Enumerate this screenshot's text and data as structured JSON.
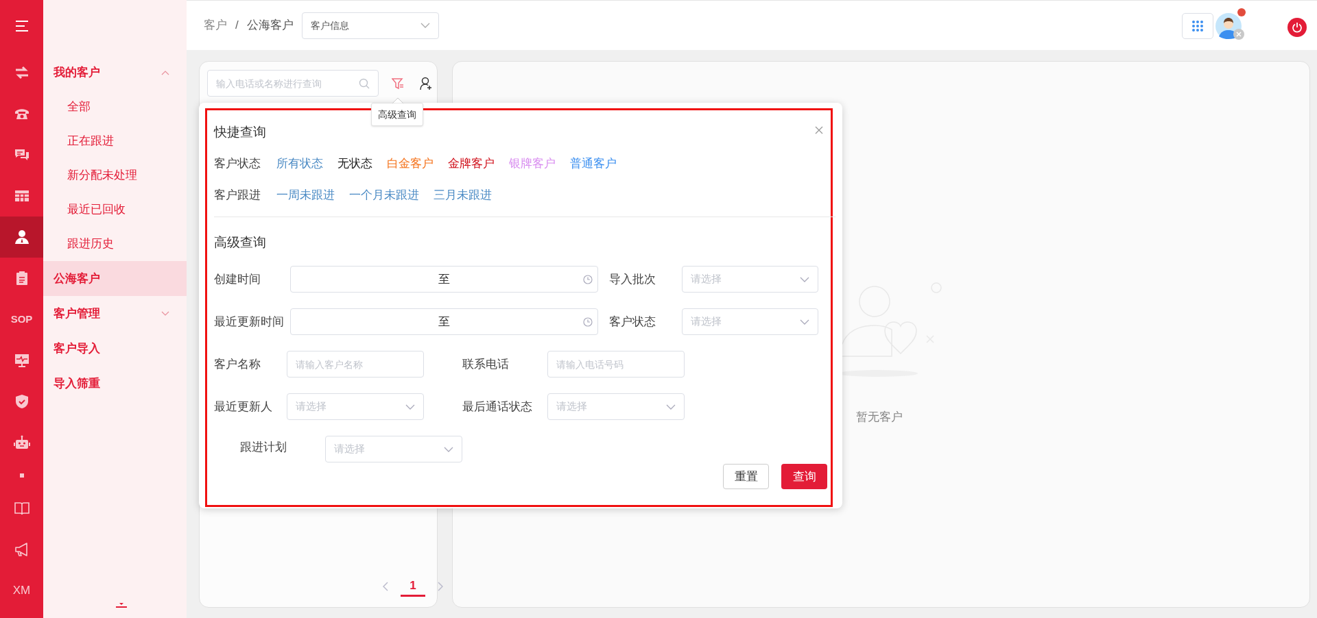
{
  "rail": [
    {
      "kind": "menu",
      "selected": false
    },
    {
      "kind": "swap",
      "selected": false
    },
    {
      "kind": "phone",
      "selected": false
    },
    {
      "kind": "chat",
      "selected": false
    },
    {
      "kind": "grid",
      "selected": false
    },
    {
      "kind": "person",
      "selected": true
    },
    {
      "kind": "clipboard",
      "selected": false
    },
    {
      "kind": "text",
      "label": "SOP",
      "selected": false
    },
    {
      "kind": "monitor",
      "selected": false
    },
    {
      "kind": "shield",
      "selected": false
    },
    {
      "kind": "robot",
      "selected": false
    },
    {
      "kind": "dot",
      "selected": false
    },
    {
      "kind": "book",
      "selected": false
    },
    {
      "kind": "megaphone",
      "selected": false
    },
    {
      "kind": "text",
      "label": "XM",
      "selected": false
    }
  ],
  "sidebar": {
    "items": [
      {
        "kind": "group",
        "label": "我的客户",
        "expanded": true,
        "selected": false,
        "children": [
          {
            "label": "全部"
          },
          {
            "label": "正在跟进"
          },
          {
            "label": "新分配未处理"
          },
          {
            "label": "最近已回收"
          },
          {
            "label": "跟进历史"
          }
        ]
      },
      {
        "kind": "link",
        "label": "公海客户",
        "selected": true
      },
      {
        "kind": "group",
        "label": "客户管理",
        "expanded": false,
        "selected": false
      },
      {
        "kind": "link",
        "label": "客户导入",
        "selected": false
      },
      {
        "kind": "link",
        "label": "导入筛重",
        "selected": false
      }
    ]
  },
  "topbar": {
    "breadcrumb": [
      "客户",
      "公海客户"
    ],
    "breadcrumb_separator": "/",
    "view_select": "客户信息",
    "has_notification": true
  },
  "list_panel": {
    "search": {
      "placeholder": "输入电话或名称进行查询"
    },
    "tooltip": "高级查询",
    "pagination": {
      "pages": [
        {
          "label": "1",
          "selected": true
        }
      ]
    }
  },
  "filter_popup": {
    "quick_title": "快捷查询",
    "status_row": {
      "label": "客户状态",
      "options": [
        {
          "label": "所有状态",
          "color": "#4a8ac4"
        },
        {
          "label": "无状态",
          "color": "#222222"
        },
        {
          "label": "白金客户",
          "color": "#f5731c"
        },
        {
          "label": "金牌客户",
          "color": "#d0101b"
        },
        {
          "label": "银牌客户",
          "color": "#d98ef0"
        },
        {
          "label": "普通客户",
          "color": "#3b8ff0"
        }
      ]
    },
    "follow_row": {
      "label": "客户跟进",
      "options": [
        "一周未跟进",
        "一个月未跟进",
        "三月未跟进"
      ]
    },
    "advanced_title": "高级查询",
    "fields": [
      [
        {
          "kind": "daterange",
          "label": "创建时间",
          "separator": "至"
        },
        {
          "kind": "select",
          "label": "导入批次",
          "placeholder": "请选择"
        }
      ],
      [
        {
          "kind": "daterange",
          "label": "最近更新时间",
          "separator": "至"
        },
        {
          "kind": "select",
          "label": "客户状态",
          "placeholder": "请选择"
        }
      ],
      [
        {
          "kind": "input",
          "label": "客户名称",
          "placeholder": "请输入客户名称"
        },
        {
          "kind": "input",
          "label": "联系电话",
          "placeholder": "请输入电话号码"
        }
      ],
      [
        {
          "kind": "select",
          "label": "最近更新人",
          "placeholder": "请选择"
        },
        {
          "kind": "select",
          "label": "最后通话状态",
          "placeholder": "请选择"
        }
      ],
      [
        {
          "kind": "select",
          "label": "跟进计划",
          "placeholder": "请选择"
        }
      ]
    ],
    "buttons": {
      "reset": "重置",
      "search": "查询"
    }
  },
  "detail_panel": {
    "empty_text": "暂无客户"
  }
}
